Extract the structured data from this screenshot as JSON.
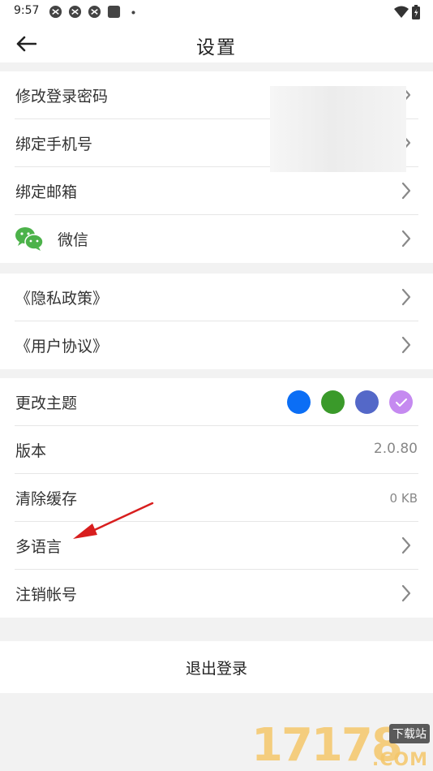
{
  "status_bar": {
    "time": "9:57"
  },
  "nav": {
    "title": "设置"
  },
  "account_group": {
    "items": [
      {
        "label": "修改登录密码"
      },
      {
        "label": "绑定手机号"
      },
      {
        "label": "绑定邮箱"
      },
      {
        "label": "微信",
        "icon": "wechat-icon"
      }
    ]
  },
  "legal_group": {
    "items": [
      {
        "label": "《隐私政策》"
      },
      {
        "label": "《用户协议》"
      }
    ]
  },
  "settings_group": {
    "theme_label": "更改主题",
    "theme_colors": [
      "#0b6ef5",
      "#3a9a2a",
      "#5468c8",
      "#c58af0"
    ],
    "theme_selected_index": 3,
    "version_label": "版本",
    "version_value": "2.0.80",
    "cache_label": "清除缓存",
    "cache_value": "0 KB",
    "language_label": "多语言",
    "delete_account_label": "注销帐号"
  },
  "logout": {
    "label": "退出登录"
  },
  "watermark": {
    "digits": "17178",
    "site": "下载站",
    "domain": ".COM"
  },
  "colors": {
    "annotation_arrow": "#d81e1e",
    "wechat": "#4cb24a"
  }
}
